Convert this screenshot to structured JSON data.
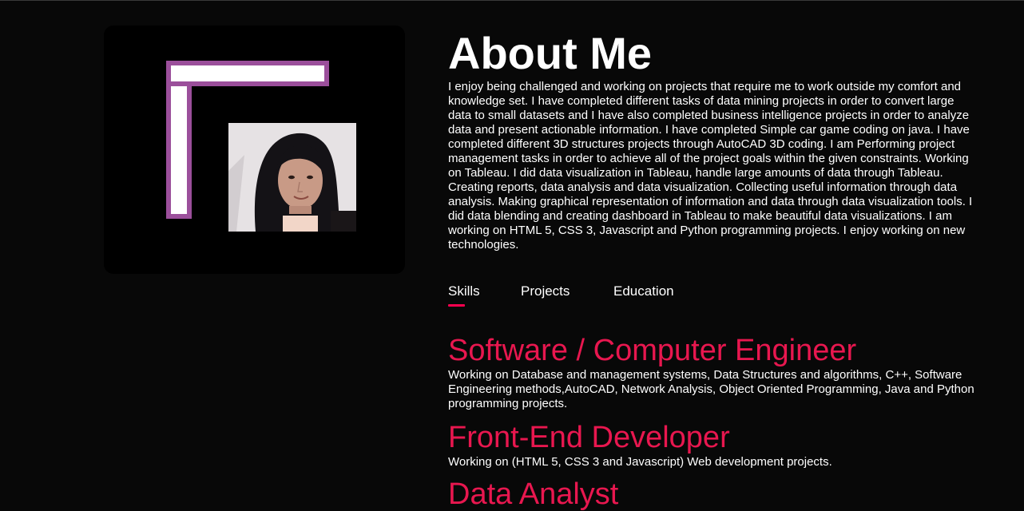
{
  "about": {
    "title": "About Me",
    "text": "I enjoy being challenged and working on projects that require me to work outside my comfort and knowledge set. I have completed different tasks of data mining projects in order to convert large data to small datasets and I have also completed business intelligence projects in order to analyze data and present actionable information. I have completed Simple car game coding on java. I have completed different 3D structures projects through AutoCAD 3D coding. I am Performing project management tasks in order to achieve all of the project goals within the given constraints. Working on Tableau. I did data visualization in Tableau, handle large amounts of data through Tableau. Creating reports, data analysis and data visualization. Collecting useful information through data analysis. Making graphical representation of information and data through data visualization tools. I did data blending and creating dashboard in Tableau to make beautiful data visualizations. I am working on HTML 5, CSS 3, Javascript and Python programming projects. I enjoy working on new technologies."
  },
  "tabs": [
    {
      "label": "Skills",
      "active": true
    },
    {
      "label": "Projects",
      "active": false
    },
    {
      "label": "Education",
      "active": false
    }
  ],
  "skills": [
    {
      "title": "Software / Computer Engineer",
      "description": "Working on Database and management systems, Data Structures and algorithms, C++, Software Engineering methods,AutoCAD, Network Analysis, Object Oriented Programming, Java and Python programming projects."
    },
    {
      "title": "Front-End Developer",
      "description": "Working on (HTML 5, CSS 3 and Javascript) Web development projects."
    },
    {
      "title": "Data Analyst",
      "description": ""
    }
  ],
  "colors": {
    "background": "#080808",
    "accent": "#e8174f",
    "tab_underline": "#ff004f",
    "frame_purple": "#9b4f9b"
  }
}
